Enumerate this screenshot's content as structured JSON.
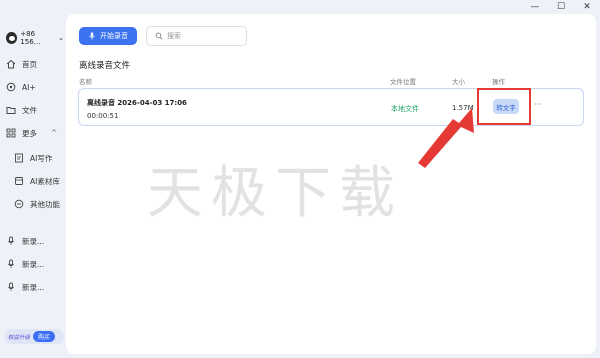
{
  "window": {
    "minimize": "—",
    "maximize": "☐",
    "close": "✕"
  },
  "sidebar": {
    "phone": "+86 156...",
    "items": [
      {
        "label": "首页"
      },
      {
        "label": "AI+"
      },
      {
        "label": "文件"
      },
      {
        "label": "更多"
      }
    ],
    "sub_items": [
      {
        "label": "AI写作"
      },
      {
        "label": "AI素材库"
      },
      {
        "label": "其他功能"
      }
    ],
    "recordings": [
      {
        "label": "新录..."
      },
      {
        "label": "新录..."
      },
      {
        "label": "新录..."
      }
    ],
    "promo_text": "权益升级",
    "promo_button": "购买"
  },
  "toolbar": {
    "record_label": "开始录音",
    "search_placeholder": "搜索"
  },
  "section_title": "离线录音文件",
  "table": {
    "columns": [
      "名称",
      "文件位置",
      "大小",
      "操作"
    ],
    "rows": [
      {
        "name": "离线录音 2026-04-03 17:06",
        "duration": "00:00:51",
        "location": "本地文件",
        "size": "1.57M",
        "action": "转文字",
        "more": "···"
      }
    ]
  },
  "watermark": "天极下载",
  "colors": {
    "accent": "#3b73f0",
    "location": "#1fa463",
    "highlight": "#e53935"
  }
}
